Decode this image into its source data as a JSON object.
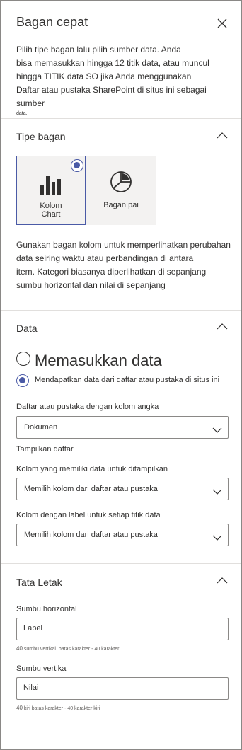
{
  "panel": {
    "title": "Bagan cepat",
    "intro": {
      "line1": "Pilih tipe bagan lalu pilih sumber data. Anda",
      "line2": "bisa memasukkan hingga 12 titik data, atau muncul",
      "line3": "hingga TITIK data SO jika Anda menggunakan",
      "line4": "Daftar atau pustaka SharePoint di situs ini sebagai sumber",
      "line5": "data."
    }
  },
  "chart_type": {
    "heading": "Tipe bagan",
    "tiles": [
      {
        "label_line1": "Kolom",
        "label_line2": "Chart",
        "icon": "column-chart-icon",
        "selected": true
      },
      {
        "label_line1": "Bagan pai",
        "label_line2": "",
        "icon": "pie-chart-icon",
        "selected": false
      }
    ],
    "description": {
      "line1": "Gunakan bagan kolom untuk memperlihatkan perubahan",
      "line2": "data seiring waktu atau perbandingan di antara",
      "line3": "item. Kategori biasanya diperlihatkan di sepanjang",
      "line4": "sumbu horizontal dan nilai di sepanjang"
    }
  },
  "data": {
    "heading": "Data",
    "option_enter": "Memasukkan data",
    "option_list": "Mendapatkan data dari daftar atau pustaka di situs ini",
    "list_label": "Daftar atau pustaka dengan kolom angka",
    "list_value": "Dokumen",
    "show_list": "Tampilkan daftar",
    "column_data_label": "Kolom yang memiliki data untuk ditampilkan",
    "column_data_value": "Memilih kolom dari daftar atau pustaka",
    "column_label_label": "Kolom dengan label untuk setiap titik data",
    "column_label_value": "Memilih kolom dari daftar atau pustaka"
  },
  "layout": {
    "heading": "Tata Letak",
    "horizontal_label": "Sumbu horizontal",
    "horizontal_value": "Label",
    "horizontal_hint_num": "40",
    "horizontal_hint": "sumbu vertikal. batas karakter - 40 karakter",
    "vertical_label": "Sumbu vertikal",
    "vertical_value": "Nilai",
    "vertical_hint_num": "40",
    "vertical_hint": "kiri batas karakter - 40 karakter kiri"
  },
  "colors": {
    "accent": "#4a5aa6",
    "text": "#323130",
    "divider": "#e1dfdd",
    "tile_bg": "#f3f2f1"
  }
}
